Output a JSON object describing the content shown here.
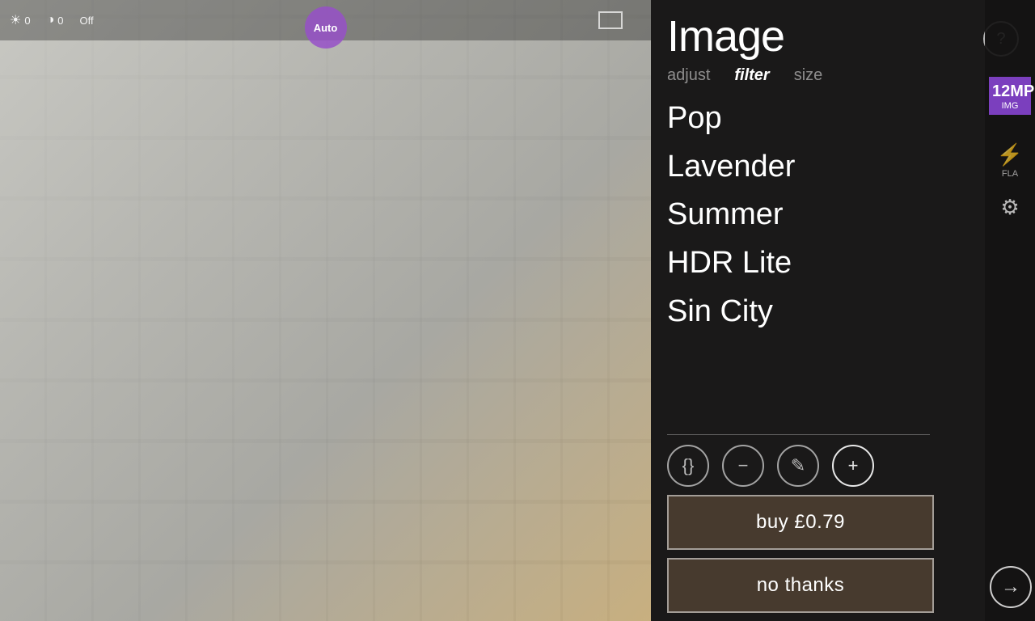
{
  "camera": {
    "top_controls": {
      "brightness": "0",
      "contrast": "0",
      "mode": "Off",
      "auto_label": "Auto"
    }
  },
  "panel": {
    "title": "Image",
    "help_label": "?",
    "tabs": [
      {
        "id": "adjust",
        "label": "adjust",
        "active": false
      },
      {
        "id": "filter",
        "label": "filter",
        "active": true
      },
      {
        "id": "size",
        "label": "size",
        "active": false
      }
    ],
    "filters": [
      {
        "id": "pop",
        "label": "Pop"
      },
      {
        "id": "lavender",
        "label": "Lavender"
      },
      {
        "id": "summer",
        "label": "Summer"
      },
      {
        "id": "hdr-lite",
        "label": "HDR Lite"
      },
      {
        "id": "sin-city",
        "label": "Sin City"
      }
    ],
    "actions": [
      {
        "id": "code",
        "symbol": "{}",
        "label": "code-icon"
      },
      {
        "id": "minus",
        "symbol": "−",
        "label": "minus-icon"
      },
      {
        "id": "edit",
        "symbol": "✎",
        "label": "edit-icon"
      },
      {
        "id": "add",
        "symbol": "+",
        "label": "add-icon"
      }
    ],
    "buy_button": "buy £0.79",
    "no_thanks_button": "no thanks"
  },
  "sidebar": {
    "mp_label": "12MP",
    "img_label": "IMG",
    "fla_label": "FLA",
    "flash_icon": "⚡",
    "gear_icon": "⚙",
    "next_icon": "→"
  }
}
